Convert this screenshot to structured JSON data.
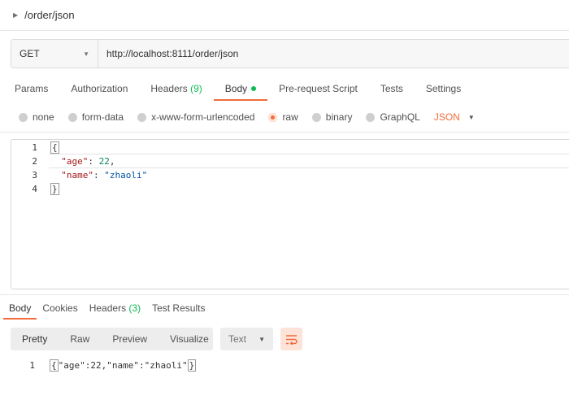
{
  "request": {
    "title": "/order/json",
    "method": "GET",
    "url": "http://localhost:8111/order/json"
  },
  "request_tabs": [
    {
      "label": "Params"
    },
    {
      "label": "Authorization"
    },
    {
      "label": "Headers",
      "count": "(9)"
    },
    {
      "label": "Body",
      "active": true,
      "indicator": "green-dot"
    },
    {
      "label": "Pre-request Script"
    },
    {
      "label": "Tests"
    },
    {
      "label": "Settings"
    }
  ],
  "body_types": [
    {
      "label": "none",
      "selected": false
    },
    {
      "label": "form-data",
      "selected": false
    },
    {
      "label": "x-www-form-urlencoded",
      "selected": false
    },
    {
      "label": "raw",
      "selected": true
    },
    {
      "label": "binary",
      "selected": false
    },
    {
      "label": "GraphQL",
      "selected": false
    }
  ],
  "body_format": "JSON",
  "editor": {
    "lines": [
      {
        "num": "1",
        "text": "{"
      },
      {
        "num": "2",
        "key": "\"age\"",
        "value": "22",
        "suffix": ","
      },
      {
        "num": "3",
        "key": "\"name\"",
        "value": "\"zhaoli\"",
        "suffix": ""
      },
      {
        "num": "4",
        "text": "}"
      }
    ]
  },
  "response_tabs": [
    {
      "label": "Body",
      "active": true
    },
    {
      "label": "Cookies"
    },
    {
      "label": "Headers",
      "count": "(3)"
    },
    {
      "label": "Test Results"
    }
  ],
  "response_views": [
    "Pretty",
    "Raw",
    "Preview",
    "Visualize"
  ],
  "response_format": "Text",
  "response": {
    "line_num": "1",
    "open": "{",
    "content": "\"age\":22,\"name\":\"zhaoli\"",
    "close": "}"
  },
  "colors": {
    "accent": "#f26b3a",
    "success": "#0cbb52"
  },
  "icons": {
    "collapse": "caret-right-icon",
    "dropdown": "caret-down-icon",
    "wrap": "wrap-lines-icon"
  }
}
